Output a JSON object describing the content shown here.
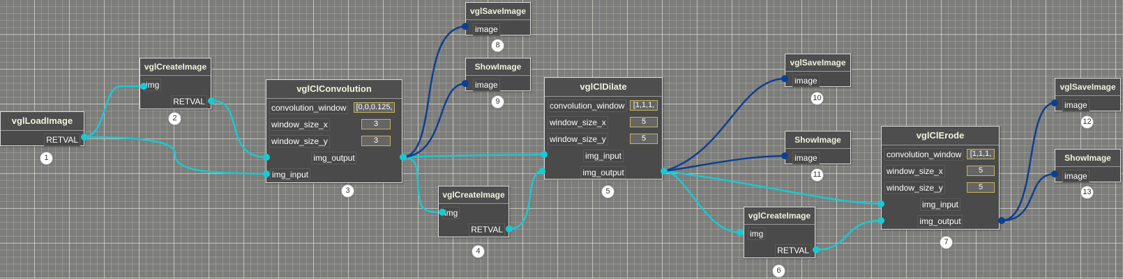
{
  "colors": {
    "background": "#7d7d7b",
    "grid_line": "#e2e2d6",
    "node_body": "#4a4a4a",
    "node_border": "#dcdcdc",
    "node_title_text": "#f2f2dc",
    "value_border": "#c7b75a",
    "wire_cyan": "#19c9d2",
    "wire_blue": "#0d3f91"
  },
  "nodes": [
    {
      "id": "1",
      "title": "vglLoadImage",
      "output_label": "RETVAL"
    },
    {
      "id": "2",
      "title": "vglCreateImage",
      "input_label": "img",
      "output_label": "RETVAL"
    },
    {
      "id": "3",
      "title": "vglClConvolution",
      "params": [
        {
          "label": "convolution_window",
          "value": "[0,0,0.125,"
        },
        {
          "label": "window_size_x",
          "value": "3"
        },
        {
          "label": "window_size_y",
          "value": "3"
        }
      ],
      "output_label": "img_output",
      "input_label": "img_input"
    },
    {
      "id": "4",
      "title": "vglCreateImage",
      "input_label": "img",
      "output_label": "RETVAL"
    },
    {
      "id": "5",
      "title": "vglClDilate",
      "params": [
        {
          "label": "convolution_window",
          "value": "[1,1,1,"
        },
        {
          "label": "window_size_x",
          "value": "5"
        },
        {
          "label": "window_size_y",
          "value": "5"
        }
      ],
      "input_label": "img_input",
      "output_label": "img_output"
    },
    {
      "id": "6",
      "title": "vglCreateImage",
      "input_label": "img",
      "output_label": "RETVAL"
    },
    {
      "id": "7",
      "title": "vglClErode",
      "params": [
        {
          "label": "convolution_window",
          "value": "[1,1,1,"
        },
        {
          "label": "window_size_x",
          "value": "5"
        },
        {
          "label": "window_size_y",
          "value": "5"
        }
      ],
      "input_label": "img_input",
      "output_label": "img_output"
    },
    {
      "id": "8",
      "title": "vglSaveImage",
      "input_label": "image"
    },
    {
      "id": "9",
      "title": "ShowImage",
      "input_label": "image"
    },
    {
      "id": "10",
      "title": "vglSaveImage",
      "input_label": "image"
    },
    {
      "id": "11",
      "title": "ShowImage",
      "input_label": "image"
    },
    {
      "id": "12",
      "title": "vglSaveImage",
      "input_label": "image"
    },
    {
      "id": "13",
      "title": "ShowImage",
      "input_label": "image"
    }
  ],
  "connections": [
    {
      "from": "1.RETVAL",
      "to": "2.img"
    },
    {
      "from": "1.RETVAL",
      "to": "3.img_input"
    },
    {
      "from": "2.RETVAL",
      "to": "3.img_output"
    },
    {
      "from": "3.img_output",
      "to": "4.img"
    },
    {
      "from": "3.img_output",
      "to": "5.img_input"
    },
    {
      "from": "3.img_output",
      "to": "8.image"
    },
    {
      "from": "3.img_output",
      "to": "9.image"
    },
    {
      "from": "4.RETVAL",
      "to": "5.img_output"
    },
    {
      "from": "5.img_output",
      "to": "6.img"
    },
    {
      "from": "5.img_output",
      "to": "7.img_input"
    },
    {
      "from": "5.img_output",
      "to": "10.image"
    },
    {
      "from": "5.img_output",
      "to": "11.image"
    },
    {
      "from": "6.RETVAL",
      "to": "7.img_output"
    },
    {
      "from": "7.img_output",
      "to": "12.image"
    },
    {
      "from": "7.img_output",
      "to": "13.image"
    }
  ]
}
